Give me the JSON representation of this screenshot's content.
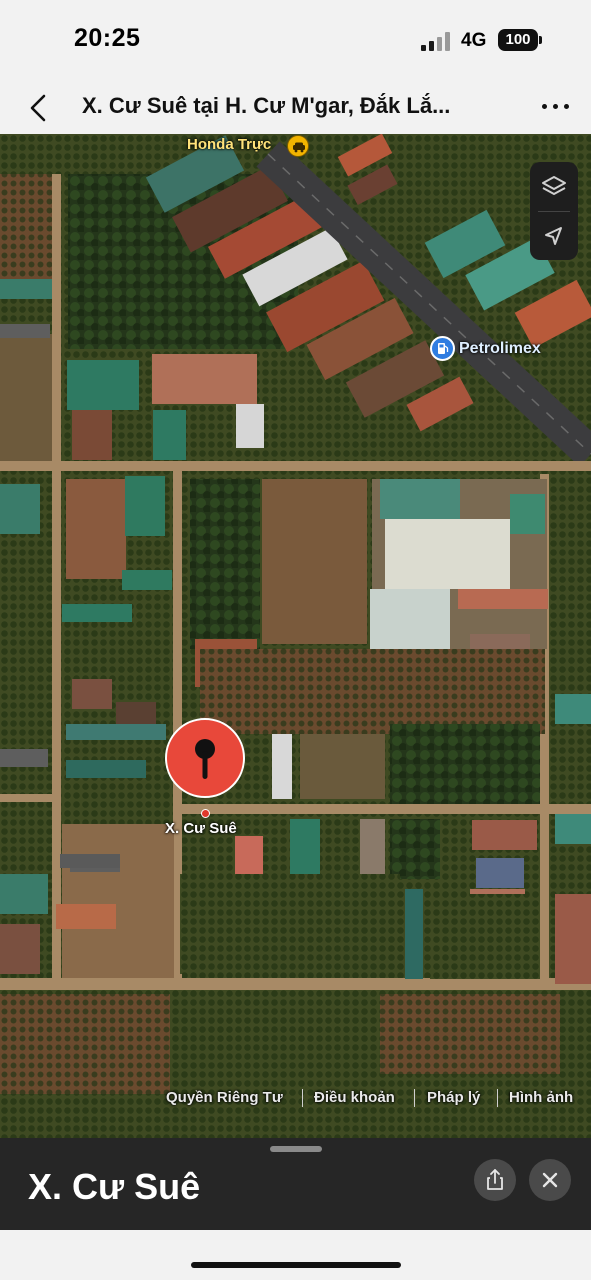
{
  "status_bar": {
    "time": "20:25",
    "network": "4G",
    "battery": "100"
  },
  "nav": {
    "title": "X. Cư Suê tại H. Cư M'gar, Đắk Lắ...",
    "back_icon": "chevron-left-icon",
    "more_icon": "ellipsis-icon"
  },
  "map": {
    "view": "satellite",
    "labels": {
      "honda": "Honda Trực",
      "petrolimex": "Petrolimex",
      "pin": "X. Cư Suê"
    },
    "controls": [
      "map-layers-icon",
      "location-arrow-icon"
    ],
    "legal": [
      "Quyền Riêng Tư",
      "Điều khoản",
      "Pháp lý",
      "Hình ảnh"
    ],
    "colors": {
      "pin": "#e8483a",
      "poi_fuel": "#2f7de1",
      "poi_car": "#f2b400"
    }
  },
  "sheet": {
    "title": "X. Cư Suê",
    "share_icon": "share-icon",
    "close_icon": "close-icon"
  }
}
